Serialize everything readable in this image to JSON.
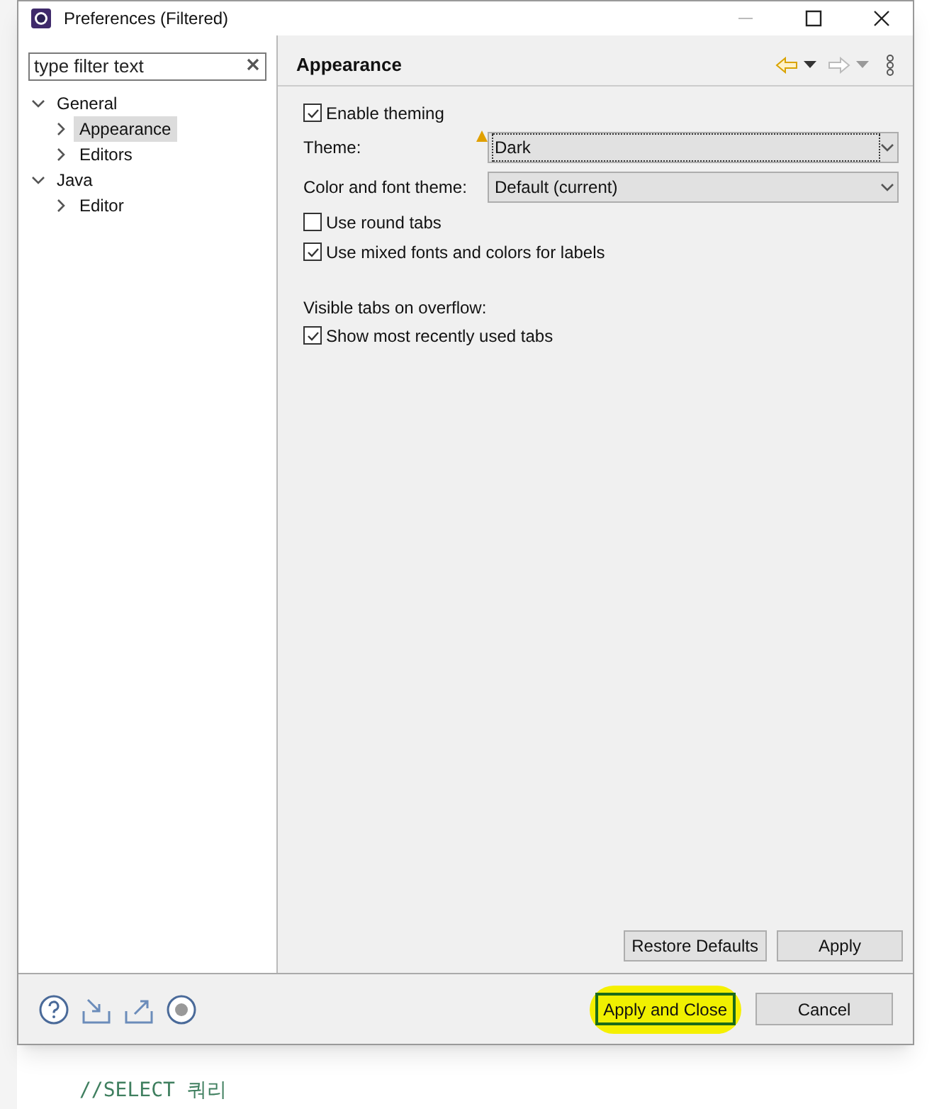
{
  "editor_behind": {
    "comment": "//SELECT 쿼리"
  },
  "window": {
    "title": "Preferences (Filtered)"
  },
  "filter": {
    "placeholder": "type filter text"
  },
  "tree": [
    {
      "label": "General",
      "expanded": true,
      "selected": false,
      "children": [
        {
          "label": "Appearance",
          "expanded": false,
          "selected": true
        },
        {
          "label": "Editors",
          "expanded": false,
          "selected": false
        }
      ]
    },
    {
      "label": "Java",
      "expanded": true,
      "selected": false,
      "children": [
        {
          "label": "Editor",
          "expanded": false,
          "selected": false
        }
      ]
    }
  ],
  "page": {
    "title": "Appearance",
    "settings": [
      {
        "kind": "checkbox",
        "label": "Enable theming",
        "checked": true
      },
      {
        "kind": "combo",
        "label": "Theme:",
        "value": "Dark",
        "warning": true,
        "focused": true
      },
      {
        "kind": "combo",
        "label": "Color and font theme:",
        "value": "Default (current)",
        "warning": false,
        "focused": false
      },
      {
        "kind": "checkbox",
        "label": "Use round tabs",
        "checked": false
      },
      {
        "kind": "checkbox",
        "label": "Use mixed fonts and colors for labels",
        "checked": true
      },
      {
        "kind": "heading",
        "label": "Visible tabs on overflow:"
      },
      {
        "kind": "checkbox",
        "label": "Show most recently used tabs",
        "checked": true
      }
    ],
    "buttons": [
      "Restore Defaults",
      "Apply"
    ]
  },
  "footer": {
    "buttons": [
      {
        "label": "Apply and Close",
        "highlighted": true
      },
      {
        "label": "Cancel",
        "highlighted": false
      }
    ]
  }
}
